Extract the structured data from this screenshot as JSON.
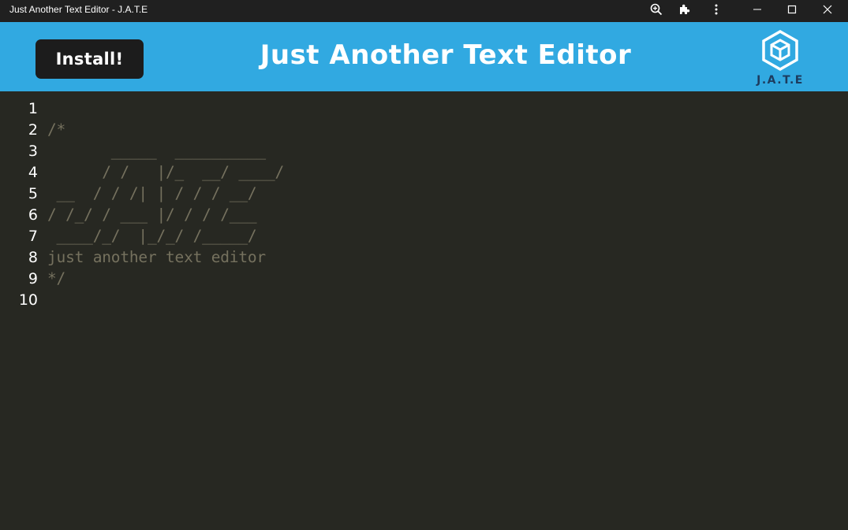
{
  "window": {
    "title": "Just Another Text Editor - J.A.T.E",
    "buttons": {
      "zoom": "zoom-icon",
      "extensions": "puzzle-icon",
      "menu": "more-vertical-icon",
      "minimize": "minimize-icon",
      "maximize": "maximize-icon",
      "close": "close-icon"
    }
  },
  "header": {
    "install_label": "Install!",
    "title": "Just Another Text Editor",
    "logo_text": "J.A.T.E",
    "background": "#31a9e1"
  },
  "editor": {
    "background": "#272822",
    "comment_color": "#75715e",
    "line_number_color": "#ffffff",
    "lines": [
      {
        "number": "1",
        "text": ""
      },
      {
        "number": "2",
        "text": "/*"
      },
      {
        "number": "3",
        "text": "       _____  __________"
      },
      {
        "number": "4",
        "text": "      / /   |/_  __/ ____/"
      },
      {
        "number": "5",
        "text": " __  / / /| | / / / __/"
      },
      {
        "number": "6",
        "text": "/ /_/ / ___ |/ / / /___"
      },
      {
        "number": "7",
        "text": " ____/_/  |_/_/ /_____/"
      },
      {
        "number": "8",
        "text": "just another text editor"
      },
      {
        "number": "9",
        "text": "*/"
      },
      {
        "number": "10",
        "text": ""
      }
    ]
  }
}
